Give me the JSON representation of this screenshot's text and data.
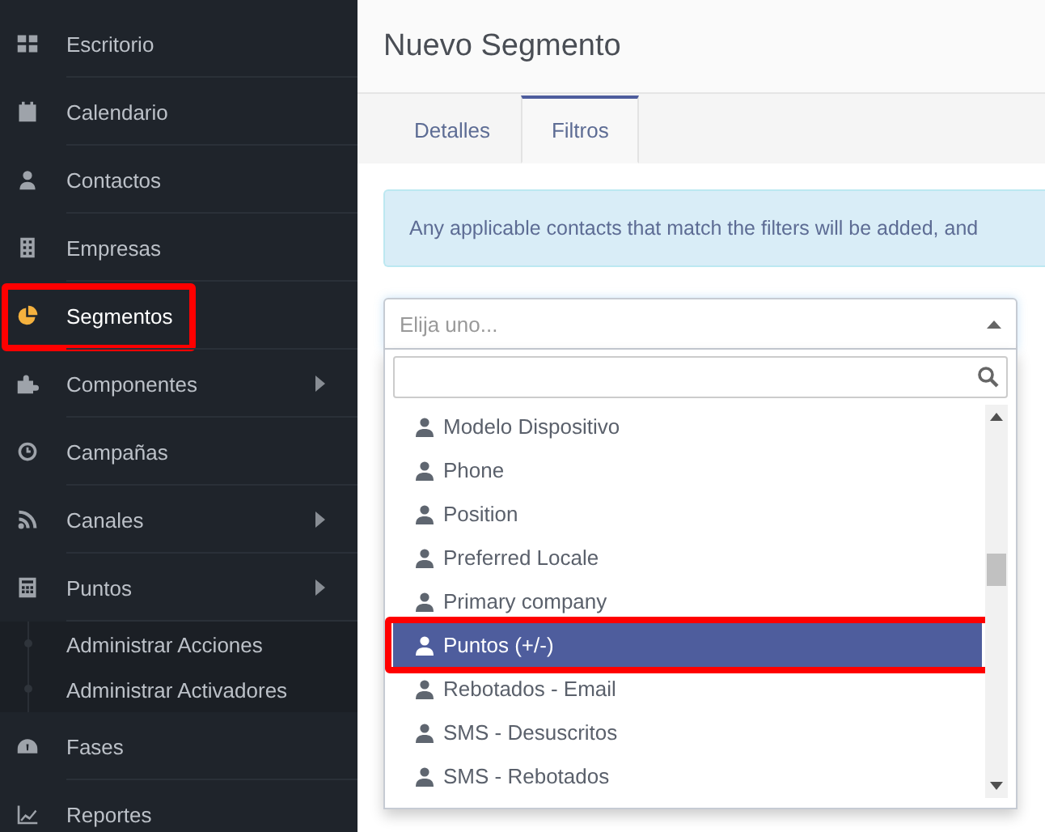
{
  "sidebar": {
    "items": [
      {
        "label": "Escritorio",
        "selected": false,
        "submenu": false
      },
      {
        "label": "Calendario",
        "selected": false,
        "submenu": false
      },
      {
        "label": "Contactos",
        "selected": false,
        "submenu": false
      },
      {
        "label": "Empresas",
        "selected": false,
        "submenu": false
      },
      {
        "label": "Segmentos",
        "selected": true,
        "submenu": false,
        "highlighted": true
      },
      {
        "label": "Componentes",
        "selected": false,
        "submenu": true
      },
      {
        "label": "Campañas",
        "selected": false,
        "submenu": false
      },
      {
        "label": "Canales",
        "selected": false,
        "submenu": true
      },
      {
        "label": "Puntos",
        "selected": false,
        "submenu": true,
        "children": [
          {
            "label": "Administrar Acciones"
          },
          {
            "label": "Administrar Activadores"
          }
        ]
      },
      {
        "label": "Fases",
        "selected": false,
        "submenu": false
      },
      {
        "label": "Reportes",
        "selected": false,
        "submenu": false
      }
    ]
  },
  "page": {
    "title": "Nuevo Segmento"
  },
  "tabs": [
    {
      "label": "Detalles",
      "selected": false
    },
    {
      "label": "Filtros",
      "selected": true
    }
  ],
  "alert": {
    "text": "Any applicable contacts that match the filters will be added, and"
  },
  "select": {
    "placeholder": "Elija uno...",
    "expanded": true,
    "options": [
      {
        "label": "Modelo Dispositivo",
        "selected": false
      },
      {
        "label": "Phone",
        "selected": false
      },
      {
        "label": "Position",
        "selected": false
      },
      {
        "label": "Preferred Locale",
        "selected": false
      },
      {
        "label": "Primary company",
        "selected": false
      },
      {
        "label": "Puntos (+/-)",
        "selected": true,
        "highlighted": true
      },
      {
        "label": "Rebotados - Email",
        "selected": false
      },
      {
        "label": "SMS - Desuscritos",
        "selected": false
      },
      {
        "label": "SMS - Rebotados",
        "selected": false
      }
    ]
  }
}
